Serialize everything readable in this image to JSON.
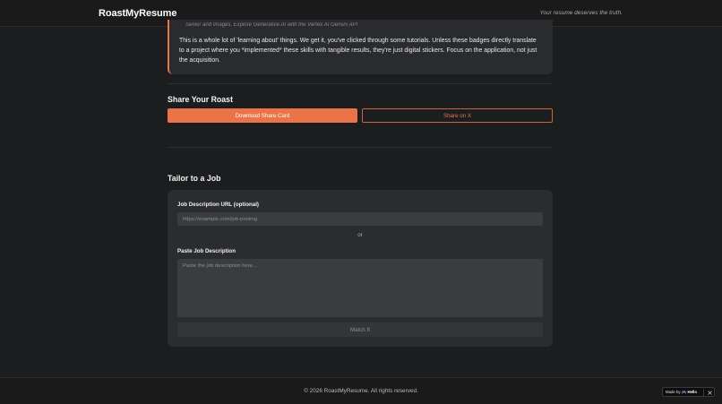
{
  "header": {
    "brand": "RoastMyResume",
    "tagline": "Your resume deserves the truth."
  },
  "feedback": {
    "cut_line": "Senior and Images, Explore Generative AI with the Vertex AI Gemini API",
    "text": "This is a whole lot of 'learning about' things. We get it, you've clicked through some tutorials. Unless these badges directly translate to a project where you *implemented* these skills with tangible results, they're just digital stickers. Focus on the application, not just the acquisition."
  },
  "share": {
    "title": "Share Your Roast",
    "download_label": "Download Share Card",
    "share_x_label": "Share on X"
  },
  "tailor": {
    "title": "Tailor to a Job",
    "url_label": "Job Description URL (optional)",
    "url_placeholder": "https://example.com/job-posting",
    "or_text": "or",
    "desc_label": "Paste Job Description",
    "desc_placeholder": "Paste the job description here...",
    "match_label": "Match It"
  },
  "footer": {
    "copyright": "© 2026 RoastMyResume. All rights reserved."
  },
  "badge": {
    "made_by": "Made by",
    "brand": "Hello",
    "icon": "close-icon"
  },
  "colors": {
    "accent": "#ea7448",
    "background": "#1c1d1f",
    "card": "#2b2c2f"
  }
}
